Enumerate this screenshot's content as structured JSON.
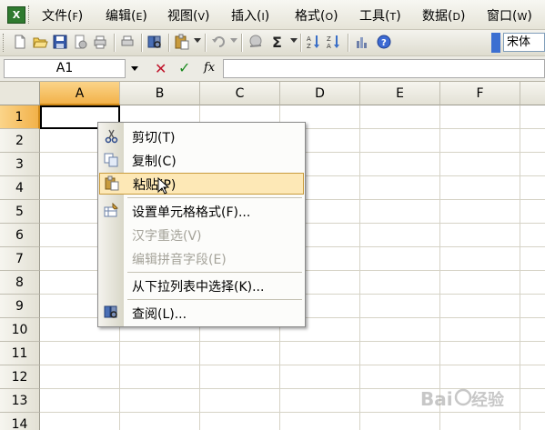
{
  "menubar": {
    "items": [
      {
        "label": "文件(",
        "key": "F",
        "end": ")"
      },
      {
        "label": "编辑(",
        "key": "E",
        "end": ")"
      },
      {
        "label": "视图(",
        "key": "V",
        "end": ")"
      },
      {
        "label": "插入(",
        "key": "I",
        "end": ")"
      },
      {
        "label": "格式(",
        "key": "O",
        "end": ")"
      },
      {
        "label": "工具(",
        "key": "T",
        "end": ")"
      },
      {
        "label": "数据(",
        "key": "D",
        "end": ")"
      },
      {
        "label": "窗口(",
        "key": "W",
        "end": ")"
      }
    ]
  },
  "toolbar": {
    "font_name": "宋体",
    "icons": [
      "new-icon",
      "open-icon",
      "save-icon",
      "permission-icon",
      "print-icon",
      "print-preview-icon",
      "research-icon",
      "paste-icon",
      "undo-icon",
      "hyperlink-icon",
      "autosum-icon",
      "sort-ascending-icon",
      "sort-descending-icon",
      "chart-icon",
      "help-icon"
    ]
  },
  "formulabar": {
    "name_box": "A1",
    "fx_label": "fx"
  },
  "grid": {
    "columns": [
      "A",
      "B",
      "C",
      "D",
      "E",
      "F"
    ],
    "rows": [
      "1",
      "2",
      "3",
      "4",
      "5",
      "6",
      "7",
      "8",
      "9",
      "10",
      "11",
      "12",
      "13",
      "14"
    ],
    "selected_column": "A",
    "selected_row": "1"
  },
  "context_menu": {
    "items": [
      {
        "label": "剪切(T)",
        "icon": "cut-icon",
        "enabled": true
      },
      {
        "label": "复制(C)",
        "icon": "copy-icon",
        "enabled": true
      },
      {
        "label": "粘贴(P)",
        "icon": "paste-icon",
        "enabled": true,
        "highlighted": true
      },
      {
        "label": "设置单元格格式(F)...",
        "icon": "format-cells-icon",
        "enabled": true
      },
      {
        "label": "汉字重选(V)",
        "icon": "",
        "enabled": false
      },
      {
        "label": "编辑拼音字段(E)",
        "icon": "",
        "enabled": false
      },
      {
        "label": "从下拉列表中选择(K)...",
        "icon": "",
        "enabled": true
      },
      {
        "label": "查阅(L)...",
        "icon": "research-icon",
        "enabled": true
      }
    ]
  },
  "colors": {
    "selection_header": "#f2b24a",
    "menu_highlight": "#fde8b6",
    "cancel": "#c0142b",
    "enter": "#1d8a21"
  }
}
